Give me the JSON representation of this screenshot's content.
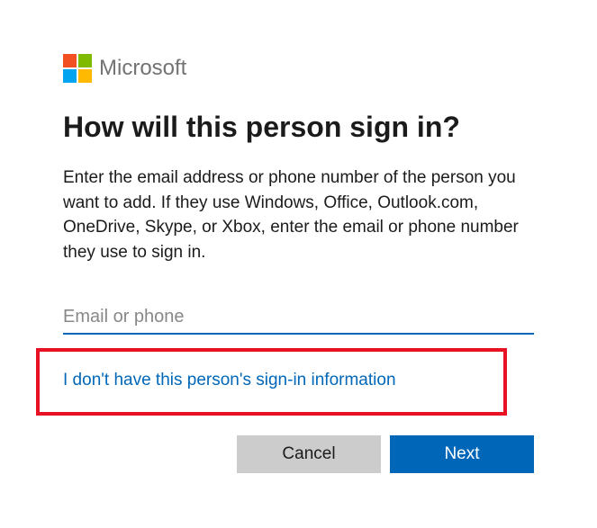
{
  "brand": {
    "name": "Microsoft"
  },
  "heading": "How will this person sign in?",
  "description": "Enter the email address or phone number of the person you want to add. If they use Windows, Office, Outlook.com, OneDrive, Skype, or Xbox, enter the email or phone number they use to sign in.",
  "input": {
    "placeholder": "Email or phone",
    "value": ""
  },
  "links": {
    "no_signin_info": "I don't have this person's sign-in information"
  },
  "buttons": {
    "cancel": "Cancel",
    "next": "Next"
  }
}
